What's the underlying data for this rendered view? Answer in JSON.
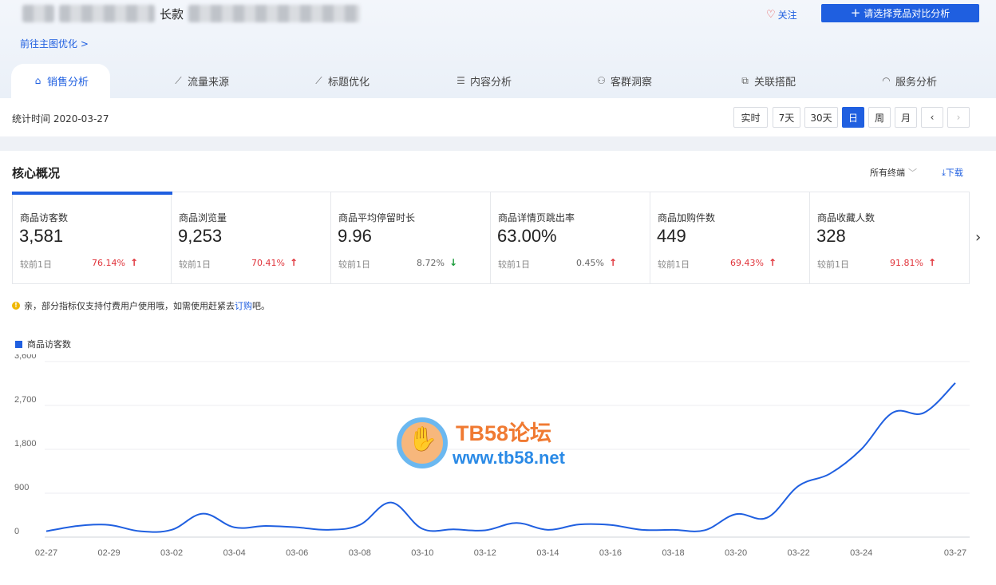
{
  "header": {
    "title_visible_part": "长款",
    "goto_link": "前往主图优化 >",
    "follow_label": "关注",
    "compare_button": "请选择竞品对比分析"
  },
  "tabs": [
    {
      "label": "销售分析",
      "icon": "shopping-bag-icon",
      "active": true
    },
    {
      "label": "流量来源",
      "icon": "line-chart-icon"
    },
    {
      "label": "标题优化",
      "icon": "trend-icon"
    },
    {
      "label": "内容分析",
      "icon": "document-icon"
    },
    {
      "label": "客群洞察",
      "icon": "users-icon"
    },
    {
      "label": "关联搭配",
      "icon": "link-icon"
    },
    {
      "label": "服务分析",
      "icon": "headset-icon"
    }
  ],
  "statbar": {
    "time_label": "统计时间 2020-03-27",
    "periods": [
      "实时",
      "7天",
      "30天",
      "日",
      "周",
      "月"
    ],
    "active_period": "日"
  },
  "core": {
    "title": "核心概况",
    "terminal_select": "所有终端",
    "download_label": "下载",
    "metrics": [
      {
        "label": "商品访客数",
        "value": "3,581",
        "cmp": "较前1日",
        "pct": "76.14%",
        "dir": "up"
      },
      {
        "label": "商品浏览量",
        "value": "9,253",
        "cmp": "较前1日",
        "pct": "70.41%",
        "dir": "up"
      },
      {
        "label": "商品平均停留时长",
        "value": "9.96",
        "cmp": "较前1日",
        "pct": "8.72%",
        "dir": "down"
      },
      {
        "label": "商品详情页跳出率",
        "value": "63.00%",
        "cmp": "较前1日",
        "pct": "0.45%",
        "dir": "up"
      },
      {
        "label": "商品加购件数",
        "value": "449",
        "cmp": "较前1日",
        "pct": "69.43%",
        "dir": "up"
      },
      {
        "label": "商品收藏人数",
        "value": "328",
        "cmp": "较前1日",
        "pct": "91.81%",
        "dir": "up"
      }
    ],
    "notice_prefix": "亲，部分指标仅支持付费用户使用哦，如需使用赶紧去",
    "notice_link": "订购",
    "notice_suffix": "吧。"
  },
  "watermark": {
    "title": "TB58论坛",
    "url": "www.tb58.net"
  },
  "colors": {
    "accent": "#1f5fe0",
    "up": "#e0333a",
    "down": "#1c9c3c"
  },
  "chart_data": {
    "type": "line",
    "series": [
      {
        "name": "商品访客数",
        "values": [
          120,
          230,
          250,
          120,
          150,
          480,
          200,
          230,
          200,
          150,
          250,
          710,
          170,
          160,
          140,
          290,
          150,
          260,
          250,
          150,
          150,
          140,
          470,
          400,
          1050,
          1300,
          1800,
          2550,
          2550,
          3160
        ]
      }
    ],
    "x_dates": [
      "02-27",
      "02-28",
      "02-29",
      "03-01",
      "03-02",
      "03-03",
      "03-04",
      "03-05",
      "03-06",
      "03-07",
      "03-08",
      "03-09",
      "03-10",
      "03-11",
      "03-12",
      "03-13",
      "03-14",
      "03-15",
      "03-16",
      "03-17",
      "03-18",
      "03-19",
      "03-20",
      "03-21",
      "03-22",
      "03-23",
      "03-24",
      "03-25",
      "03-26",
      "03-27"
    ],
    "x_tick_labels": [
      "02-27",
      "02-29",
      "03-02",
      "03-04",
      "03-06",
      "03-08",
      "03-10",
      "03-12",
      "03-14",
      "03-16",
      "03-18",
      "03-20",
      "03-22",
      "03-24",
      "03-27"
    ],
    "y_ticks": [
      0,
      900,
      1800,
      2700,
      3600
    ],
    "y_tick_labels": [
      "0",
      "900",
      "1,800",
      "2,700",
      "3,600"
    ],
    "ylim": [
      0,
      3600
    ],
    "grid": true,
    "legend_position": "top-left"
  }
}
